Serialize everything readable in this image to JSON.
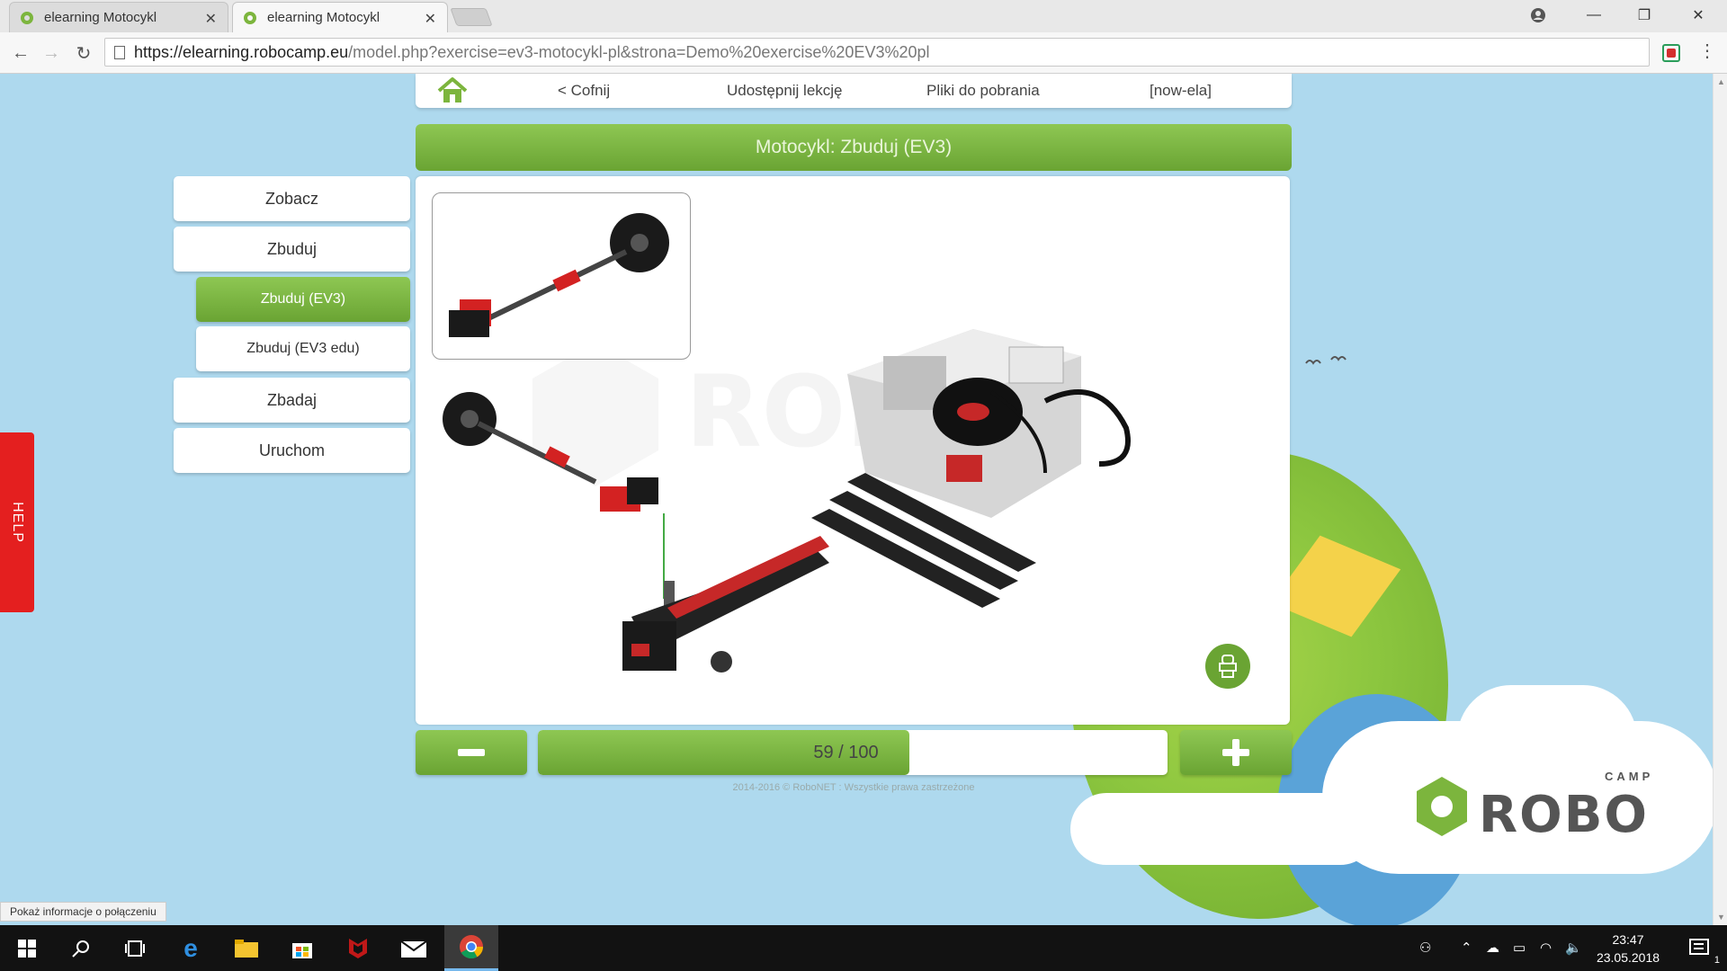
{
  "browser": {
    "tabs": [
      {
        "title": "elearning Motocykl"
      },
      {
        "title": "elearning Motocykl"
      }
    ],
    "url_host": "https://elearning.robocamp.eu",
    "url_path": "/model.php?exercise=ev3-motocykl-pl&strona=Demo%20exercise%20EV3%20pl",
    "tooltip": "Pokaż informacje o połączeniu"
  },
  "nav": {
    "back": "< Cofnij",
    "share": "Udostępnij lekcję",
    "downloads": "Pliki do pobrania",
    "user": "[now-ela]"
  },
  "page_title": "Motocykl: Zbuduj (EV3)",
  "sidebar": {
    "items": [
      {
        "label": "Zobacz"
      },
      {
        "label": "Zbuduj"
      },
      {
        "label": "Zbuduj (EV3)"
      },
      {
        "label": "Zbuduj (EV3 edu)"
      },
      {
        "label": "Zbadaj"
      },
      {
        "label": "Uruchom"
      }
    ]
  },
  "help_label": "HELP",
  "progress": {
    "current": 59,
    "total": 100,
    "text": "59 / 100"
  },
  "footer": "2014-2016 © RoboNET : Wszystkie prawa zastrzeżone",
  "logo": {
    "main": "ROBO",
    "small": "CAMP"
  },
  "taskbar": {
    "time": "23:47",
    "date": "23.05.2018",
    "notifications": "1"
  },
  "colors": {
    "accent_green": "#7cb53d",
    "sky": "#aed9ee",
    "help_red": "#e41f1f"
  }
}
